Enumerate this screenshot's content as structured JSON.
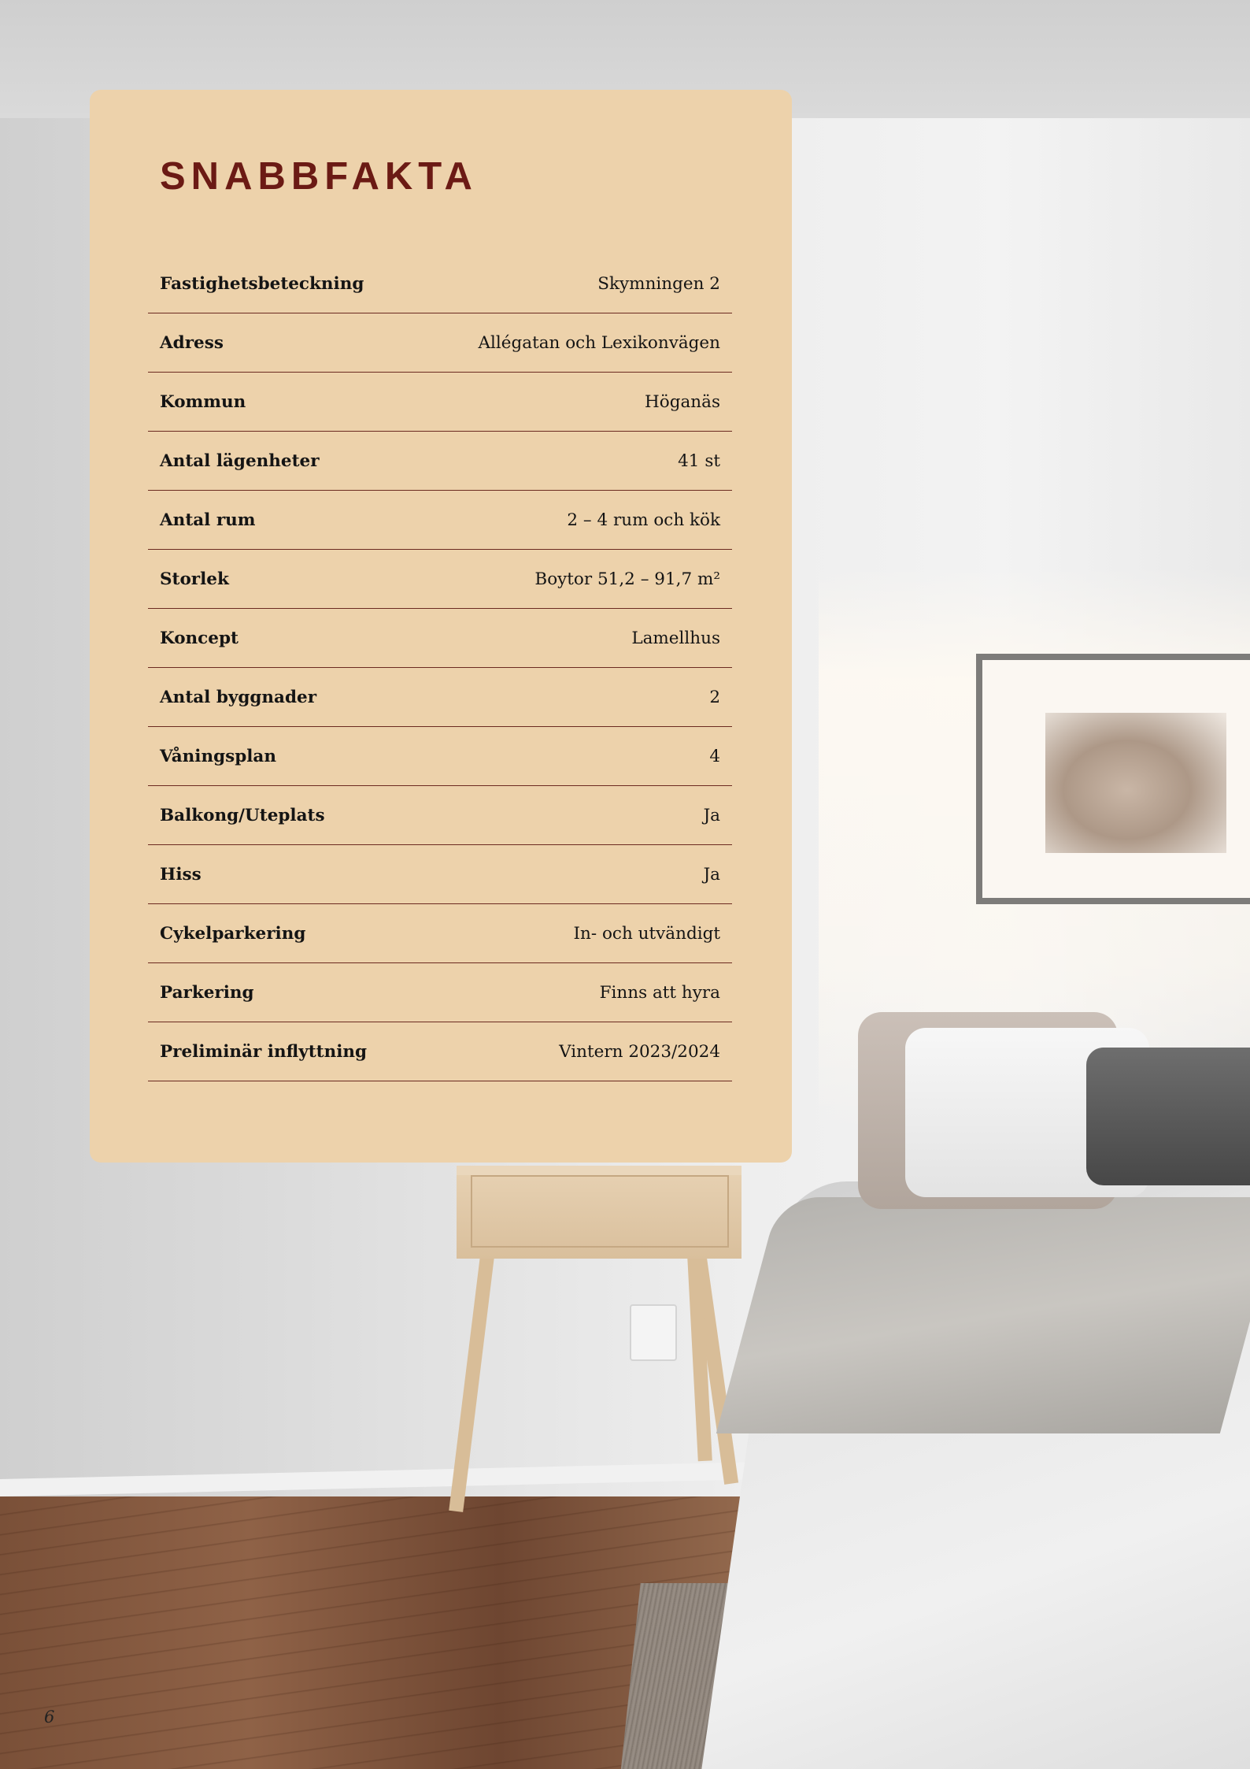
{
  "card": {
    "title": "SNABBFAKTA",
    "facts": [
      {
        "label": "Fastighetsbeteckning",
        "value": "Skymningen 2"
      },
      {
        "label": "Adress",
        "value": "Allégatan och Lexikonvägen"
      },
      {
        "label": "Kommun",
        "value": "Höganäs"
      },
      {
        "label": "Antal lägenheter",
        "value": "41 st"
      },
      {
        "label": "Antal rum",
        "value": "2 – 4 rum och kök"
      },
      {
        "label": "Storlek",
        "value": "Boytor 51,2 – 91,7 m²"
      },
      {
        "label": "Koncept",
        "value": "Lamellhus"
      },
      {
        "label": "Antal byggnader",
        "value": "2"
      },
      {
        "label": "Våningsplan",
        "value": "4"
      },
      {
        "label": "Balkong/Uteplats",
        "value": "Ja"
      },
      {
        "label": "Hiss",
        "value": "Ja"
      },
      {
        "label": "Cykelparkering",
        "value": "In- och utvändigt"
      },
      {
        "label": "Parkering",
        "value": "Finns att hyra"
      },
      {
        "label": "Preliminär inflyttning",
        "value": "Vintern 2023/2024"
      }
    ]
  },
  "page": {
    "number": "6"
  },
  "colors": {
    "card_bg": "#edd2ab",
    "title": "#6b1a14",
    "rule": "#6b2a20"
  }
}
